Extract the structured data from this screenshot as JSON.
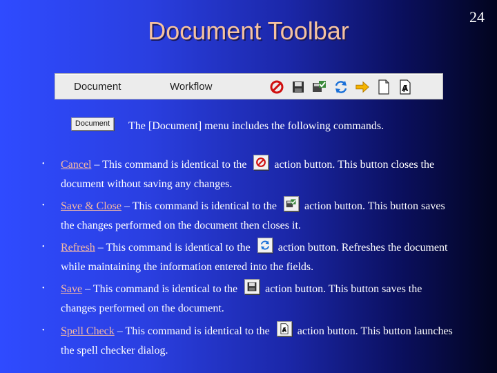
{
  "slide": {
    "page_number": "24",
    "title": "Document Toolbar"
  },
  "toolbar": {
    "menus": [
      "Document",
      "Workflow"
    ],
    "icons": [
      "cancel-icon",
      "save-icon",
      "save-close-icon",
      "refresh-icon",
      "forward-arrow-icon",
      "new-page-icon",
      "spell-check-icon"
    ]
  },
  "intro": {
    "button_label": "Document",
    "text": "The [Document] menu includes the following commands."
  },
  "commands": [
    {
      "name": "Cancel",
      "text_before": " – This command is identical to the ",
      "text_after": " action button.  This button closes the document without saving any changes.",
      "icon": "cancel-icon"
    },
    {
      "name": "Save & Close",
      "text_before": " – This command is identical to the ",
      "text_after": " action button.  This button saves the changes performed on the document then closes it.",
      "icon": "save-close-icon"
    },
    {
      "name": "Refresh",
      "text_before": " – This command is identical to the ",
      "text_after": " action button.  Refreshes the document while maintaining the information entered into the fields.",
      "icon": "refresh-icon"
    },
    {
      "name": "Save",
      "text_before": " – This command is identical to the ",
      "text_after": " action button.  This button saves the changes performed on the document.",
      "icon": "save-icon"
    },
    {
      "name": "Spell Check",
      "text_before": " – This command is identical to the ",
      "text_after": " action button.  This button launches the spell checker dialog.",
      "icon": "spell-check-icon"
    }
  ],
  "colors": {
    "title": "#f5c2a0",
    "link": "#f5b9a3",
    "text": "#ffffff",
    "background_left": "#2f4bff",
    "background_right": "#02041e"
  }
}
